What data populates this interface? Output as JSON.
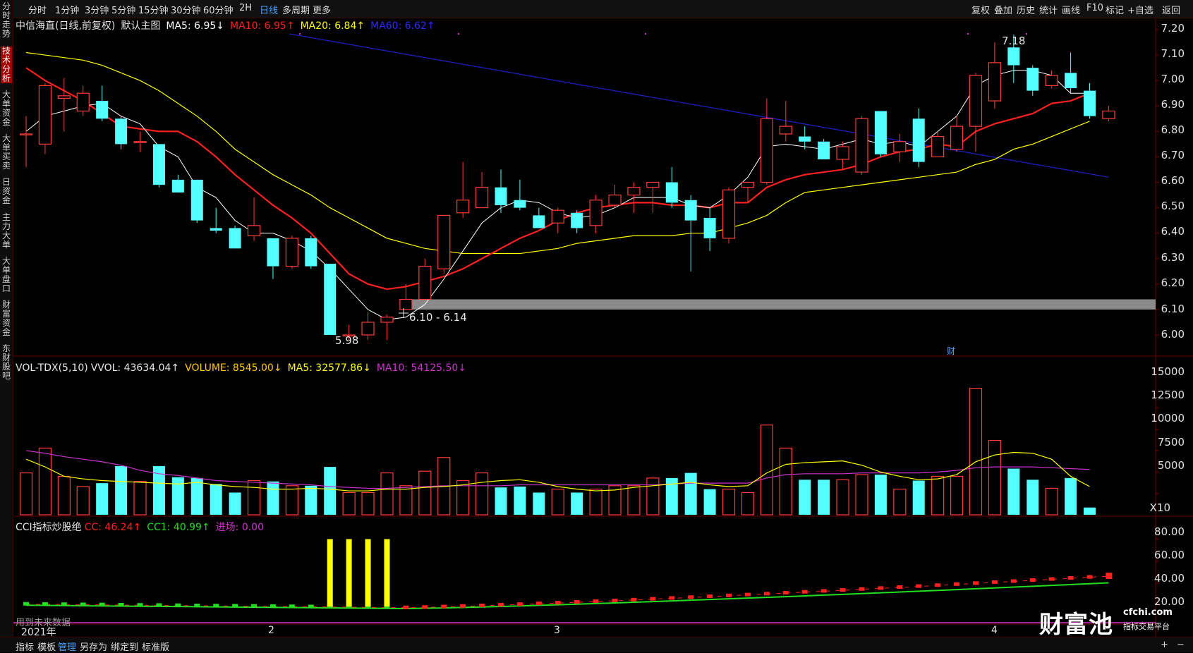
{
  "colors": {
    "up": "#ff3b3b",
    "down": "#54ffff",
    "ma5": "#ffffff",
    "ma10": "#ff2020",
    "ma20": "#ffff00",
    "ma60": "#1e1ebf",
    "vol_ma5": "#ffff00",
    "vol_ma10": "#cc33cc",
    "cc": "#ff2020",
    "cc1": "#22dd22",
    "signal": "#ffff00",
    "accent": "#4aa3ff"
  },
  "toolbar": {
    "periods": [
      "分时",
      "1分钟",
      "3分钟",
      "5分钟",
      "15分钟",
      "30分钟",
      "60分钟",
      "2H",
      "日线",
      "多周期",
      "更多"
    ],
    "active_period": "日线",
    "right_tools": [
      "复权",
      "叠加",
      "历史",
      "统计",
      "画线",
      "F10",
      "标记",
      "+自选",
      "返回"
    ]
  },
  "left_tabs": [
    {
      "label": "分时走势",
      "active": false
    },
    {
      "label": "技术分析",
      "active": true
    },
    {
      "label": "大单资金",
      "active": false
    },
    {
      "label": "大单买卖",
      "active": false
    },
    {
      "label": "日资金",
      "active": false
    },
    {
      "label": "主力大单",
      "active": false
    },
    {
      "label": "大单盘口",
      "active": false
    },
    {
      "label": "财富资金",
      "active": false
    },
    {
      "label": "东财股吧",
      "active": false
    }
  ],
  "main_legend": {
    "title": "中信海直(日线,前复权)",
    "indicator": "默认主图",
    "ma5": "MA5: 6.95↓",
    "ma10": "MA10: 6.95↑",
    "ma20": "MA20: 6.84↑",
    "ma60": "MA60: 6.62↑"
  },
  "price_axis": [
    "7.20",
    "7.10",
    "7.00",
    "6.90",
    "6.80",
    "6.70",
    "6.60",
    "6.50",
    "6.40",
    "6.30",
    "6.20",
    "6.10",
    "6.00"
  ],
  "annotations": {
    "high": "7.18",
    "low": "5.98",
    "zone": "6.10 - 6.14",
    "cai": "财"
  },
  "vol_legend": {
    "title": "VOL-TDX(5,10)",
    "vvol": "VVOL: 43634.04↑",
    "volume": "VOLUME: 8545.00↓",
    "ma5": "MA5: 32577.86↓",
    "ma10": "MA10: 54125.50↓"
  },
  "vol_axis": [
    "15000",
    "12500",
    "10000",
    "7500",
    "5000"
  ],
  "vol_unit": "X10",
  "cci_legend": {
    "title": "CCI指标炒股绝",
    "cc": "CC: 46.24↑",
    "cc1": "CC1: 40.99↑",
    "entry": "进场: 0.00"
  },
  "cci_axis": [
    "80.00",
    "60.00",
    "40.00",
    "20.00"
  ],
  "future_note": "用到未来数据",
  "x_labels": [
    "2021年",
    "2",
    "3",
    "4"
  ],
  "watermark": {
    "brand": "财富池",
    "site": "cfchi.com",
    "slogan": "指标交易平台"
  },
  "bottom_tabs": [
    "指标",
    "模板",
    "管理",
    "另存为",
    "绑定到",
    "标准版"
  ],
  "active_bottom_tab": "管理",
  "chart_data": {
    "type": "candlestick",
    "candles": [
      {
        "o": 6.79,
        "c": 6.79,
        "h": 6.86,
        "l": 6.66
      },
      {
        "o": 6.75,
        "c": 6.98,
        "h": 6.99,
        "l": 6.71
      },
      {
        "o": 6.93,
        "c": 6.94,
        "h": 7.01,
        "l": 6.8
      },
      {
        "o": 6.88,
        "c": 6.95,
        "h": 6.98,
        "l": 6.86
      },
      {
        "o": 6.92,
        "c": 6.85,
        "h": 6.98,
        "l": 6.84
      },
      {
        "o": 6.85,
        "c": 6.75,
        "h": 6.86,
        "l": 6.73
      },
      {
        "o": 6.76,
        "c": 6.76,
        "h": 6.8,
        "l": 6.72
      },
      {
        "o": 6.75,
        "c": 6.59,
        "h": 6.75,
        "l": 6.58
      },
      {
        "o": 6.61,
        "c": 6.56,
        "h": 6.63,
        "l": 6.56
      },
      {
        "o": 6.61,
        "c": 6.45,
        "h": 6.61,
        "l": 6.44
      },
      {
        "o": 6.42,
        "c": 6.41,
        "h": 6.5,
        "l": 6.4
      },
      {
        "o": 6.42,
        "c": 6.34,
        "h": 6.43,
        "l": 6.34
      },
      {
        "o": 6.39,
        "c": 6.43,
        "h": 6.54,
        "l": 6.37
      },
      {
        "o": 6.38,
        "c": 6.27,
        "h": 6.38,
        "l": 6.22
      },
      {
        "o": 6.27,
        "c": 6.38,
        "h": 6.39,
        "l": 6.26
      },
      {
        "o": 6.38,
        "c": 6.27,
        "h": 6.39,
        "l": 6.26
      },
      {
        "o": 6.28,
        "c": 6.0,
        "h": 6.28,
        "l": 6.0
      },
      {
        "o": 6.0,
        "c": 6.0,
        "h": 6.04,
        "l": 5.98
      },
      {
        "o": 6.0,
        "c": 6.05,
        "h": 6.09,
        "l": 5.98
      },
      {
        "o": 6.05,
        "c": 6.07,
        "h": 6.08,
        "l": 5.98
      },
      {
        "o": 6.1,
        "c": 6.14,
        "h": 6.2,
        "l": 6.1
      },
      {
        "o": 6.14,
        "c": 6.27,
        "h": 6.3,
        "l": 6.14
      },
      {
        "o": 6.26,
        "c": 6.47,
        "h": 6.47,
        "l": 6.24
      },
      {
        "o": 6.48,
        "c": 6.53,
        "h": 6.68,
        "l": 6.46
      },
      {
        "o": 6.5,
        "c": 6.58,
        "h": 6.64,
        "l": 6.5
      },
      {
        "o": 6.58,
        "c": 6.51,
        "h": 6.65,
        "l": 6.48
      },
      {
        "o": 6.53,
        "c": 6.5,
        "h": 6.61,
        "l": 6.49
      },
      {
        "o": 6.47,
        "c": 6.42,
        "h": 6.5,
        "l": 6.42
      },
      {
        "o": 6.44,
        "c": 6.49,
        "h": 6.5,
        "l": 6.4
      },
      {
        "o": 6.48,
        "c": 6.42,
        "h": 6.49,
        "l": 6.4
      },
      {
        "o": 6.43,
        "c": 6.53,
        "h": 6.55,
        "l": 6.4
      },
      {
        "o": 6.51,
        "c": 6.55,
        "h": 6.59,
        "l": 6.5
      },
      {
        "o": 6.55,
        "c": 6.58,
        "h": 6.6,
        "l": 6.48
      },
      {
        "o": 6.58,
        "c": 6.6,
        "h": 6.6,
        "l": 6.48
      },
      {
        "o": 6.6,
        "c": 6.52,
        "h": 6.66,
        "l": 6.5
      },
      {
        "o": 6.53,
        "c": 6.45,
        "h": 6.55,
        "l": 6.25
      },
      {
        "o": 6.46,
        "c": 6.38,
        "h": 6.5,
        "l": 6.33
      },
      {
        "o": 6.38,
        "c": 6.57,
        "h": 6.58,
        "l": 6.36
      },
      {
        "o": 6.58,
        "c": 6.6,
        "h": 6.59,
        "l": 6.52
      },
      {
        "o": 6.6,
        "c": 6.85,
        "h": 6.93,
        "l": 6.59
      },
      {
        "o": 6.79,
        "c": 6.82,
        "h": 6.92,
        "l": 6.76
      },
      {
        "o": 6.78,
        "c": 6.76,
        "h": 6.82,
        "l": 6.73
      },
      {
        "o": 6.76,
        "c": 6.69,
        "h": 6.77,
        "l": 6.69
      },
      {
        "o": 6.69,
        "c": 6.74,
        "h": 6.76,
        "l": 6.65
      },
      {
        "o": 6.64,
        "c": 6.85,
        "h": 6.86,
        "l": 6.63
      },
      {
        "o": 6.88,
        "c": 6.71,
        "h": 6.88,
        "l": 6.7
      },
      {
        "o": 6.72,
        "c": 6.76,
        "h": 6.79,
        "l": 6.68
      },
      {
        "o": 6.85,
        "c": 6.68,
        "h": 6.89,
        "l": 6.66
      },
      {
        "o": 6.7,
        "c": 6.78,
        "h": 6.8,
        "l": 6.7
      },
      {
        "o": 6.73,
        "c": 6.82,
        "h": 6.86,
        "l": 6.72
      },
      {
        "o": 6.82,
        "c": 7.02,
        "h": 7.03,
        "l": 6.72
      },
      {
        "o": 6.92,
        "c": 7.07,
        "h": 7.15,
        "l": 6.89
      },
      {
        "o": 7.13,
        "c": 7.06,
        "h": 7.18,
        "l": 6.99
      },
      {
        "o": 7.05,
        "c": 6.96,
        "h": 7.06,
        "l": 6.94
      },
      {
        "o": 6.98,
        "c": 7.02,
        "h": 7.04,
        "l": 6.97
      },
      {
        "o": 7.03,
        "c": 6.97,
        "h": 7.11,
        "l": 6.95
      },
      {
        "o": 6.96,
        "c": 6.86,
        "h": 6.99,
        "l": 6.85
      },
      {
        "o": 6.85,
        "c": 6.88,
        "h": 6.9,
        "l": 6.84
      }
    ],
    "ma5": [
      6.8,
      6.86,
      6.88,
      6.9,
      6.91,
      6.86,
      6.83,
      6.74,
      6.7,
      6.58,
      6.54,
      6.45,
      6.4,
      6.4,
      6.37,
      6.33,
      6.26,
      6.18,
      6.1,
      6.06,
      6.07,
      6.12,
      6.22,
      6.33,
      6.44,
      6.5,
      6.53,
      6.52,
      6.48,
      6.46,
      6.47,
      6.5,
      6.54,
      6.54,
      6.54,
      6.51,
      6.5,
      6.55,
      6.62,
      6.74,
      6.75,
      6.74,
      6.73,
      6.75,
      6.77,
      6.75,
      6.76,
      6.74,
      6.8,
      6.86,
      6.98,
      7.02,
      7.04,
      7.04,
      7.02,
      6.95,
      6.95
    ],
    "ma10": [
      7.05,
      7.0,
      6.96,
      6.92,
      6.87,
      6.82,
      6.81,
      6.8,
      6.8,
      6.76,
      6.7,
      6.63,
      6.57,
      6.51,
      6.46,
      6.4,
      6.32,
      6.24,
      6.2,
      6.18,
      6.19,
      6.21,
      6.23,
      6.26,
      6.3,
      6.34,
      6.38,
      6.41,
      6.45,
      6.48,
      6.5,
      6.51,
      6.52,
      6.52,
      6.51,
      6.51,
      6.5,
      6.52,
      6.52,
      6.58,
      6.61,
      6.63,
      6.64,
      6.65,
      6.67,
      6.7,
      6.72,
      6.73,
      6.75,
      6.74,
      6.8,
      6.83,
      6.85,
      6.87,
      6.91,
      6.92,
      6.95
    ],
    "ma20": [
      7.11,
      7.1,
      7.09,
      7.08,
      7.06,
      7.03,
      7.0,
      6.96,
      6.91,
      6.86,
      6.8,
      6.73,
      6.68,
      6.63,
      6.59,
      6.55,
      6.5,
      6.46,
      6.42,
      6.38,
      6.36,
      6.34,
      6.33,
      6.32,
      6.32,
      6.32,
      6.32,
      6.33,
      6.34,
      6.36,
      6.37,
      6.38,
      6.39,
      6.39,
      6.39,
      6.4,
      6.4,
      6.42,
      6.44,
      6.47,
      6.52,
      6.56,
      6.57,
      6.58,
      6.59,
      6.6,
      6.61,
      6.62,
      6.63,
      6.64,
      6.67,
      6.69,
      6.73,
      6.75,
      6.78,
      6.81,
      6.84
    ],
    "ma60_start": 7.38,
    "ma60_end": 6.62,
    "volume": [
      4900,
      7800,
      4500,
      3300,
      3700,
      5700,
      3900,
      5700,
      4400,
      4300,
      3600,
      2600,
      4000,
      3900,
      3400,
      3400,
      5600,
      2600,
      2600,
      4900,
      3400,
      5100,
      6700,
      4000,
      4900,
      3200,
      3300,
      2600,
      3000,
      2600,
      3000,
      3400,
      3400,
      4300,
      4300,
      4900,
      3000,
      3000,
      2600,
      10500,
      7800,
      4100,
      4100,
      4100,
      4700,
      4700,
      3000,
      4000,
      4500,
      4500,
      14800,
      8700,
      5400,
      4100,
      3100,
      4300,
      850
    ],
    "vol_ma5": [
      6500,
      5600,
      4500,
      4200,
      4000,
      3900,
      3800,
      3700,
      3600,
      3800,
      3500,
      3300,
      3200,
      3000,
      3000,
      3100,
      3000,
      2800,
      2800,
      3000,
      3000,
      3200,
      3300,
      3500,
      3800,
      4000,
      4100,
      3800,
      3300,
      3000,
      2800,
      2900,
      3200,
      3400,
      3600,
      3800,
      3500,
      3300,
      3400,
      4900,
      5900,
      6100,
      6200,
      6300,
      5800,
      5000,
      4500,
      4100,
      4200,
      4700,
      6200,
      7000,
      7300,
      7200,
      6500,
      4500,
      3300
    ],
    "vol_ma10": [
      7500,
      7200,
      6800,
      6500,
      6200,
      5800,
      5200,
      4800,
      4600,
      4300,
      4000,
      3900,
      3800,
      3700,
      3600,
      3500,
      3300,
      3200,
      3100,
      3100,
      3200,
      3300,
      3400,
      3400,
      3400,
      3400,
      3500,
      3500,
      3500,
      3500,
      3500,
      3500,
      3500,
      3500,
      3600,
      3700,
      3700,
      3700,
      3700,
      4300,
      4700,
      4800,
      4800,
      4800,
      4900,
      4900,
      4900,
      4900,
      5000,
      5200,
      5500,
      5600,
      5600,
      5600,
      5500,
      5400,
      5300
    ],
    "cc_start": 20.8,
    "cc_end": 46.24,
    "cc_min": 17.6,
    "cc_min_index": 20,
    "cc1_start": 20.6,
    "cc1_end": 40.99,
    "entry_bars": [
      16,
      17,
      18,
      19
    ],
    "entry_value": 80
  }
}
